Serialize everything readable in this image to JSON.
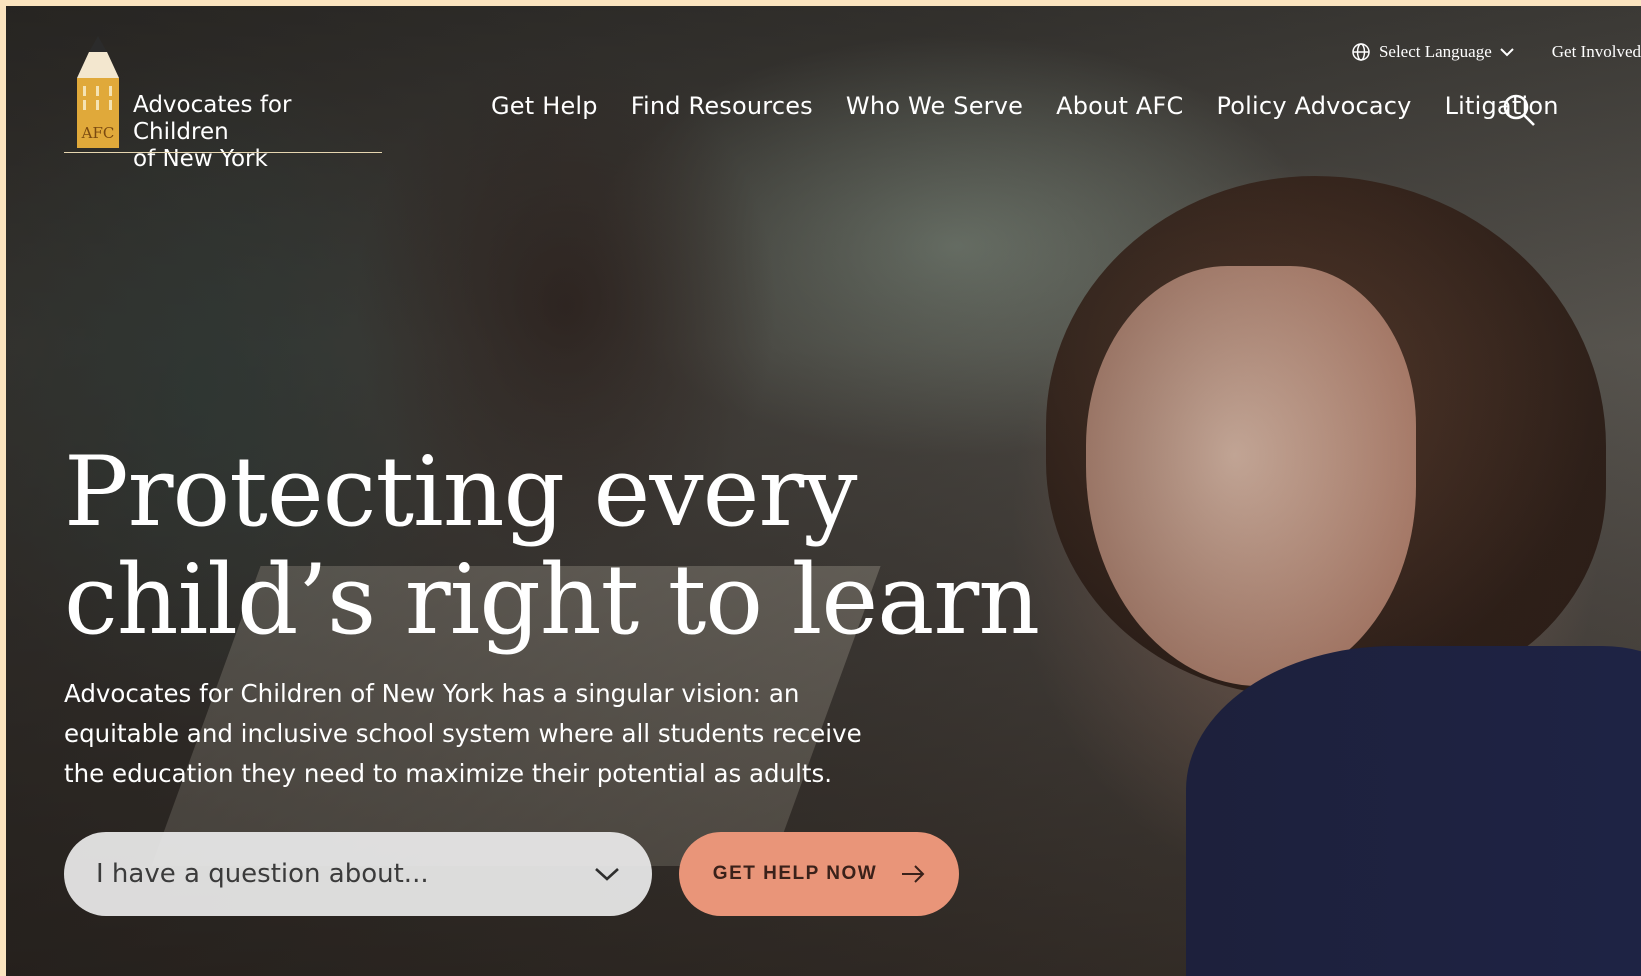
{
  "logo": {
    "line1": "Advocates for Children",
    "line2": "of New York",
    "badge": "AFC"
  },
  "utility": {
    "language_label": "Select Language",
    "get_involved": "Get Involved"
  },
  "nav": {
    "items": [
      "Get Help",
      "Find Resources",
      "Who We Serve",
      "About AFC",
      "Policy Advocacy",
      "Litigation"
    ]
  },
  "hero": {
    "headline_line1": "Protecting every",
    "headline_line2": "child’s right to learn",
    "description": "Advocates for Children of New York has a singular vision: an equitable and inclusive school system where all students receive the education they need to maximize their potential as adults.",
    "question_placeholder": "I have a question about...",
    "cta_label": "GET HELP NOW"
  },
  "icons": {
    "globe": "globe-icon",
    "chevron": "chevron-down-icon",
    "search": "search-icon",
    "arrow": "arrow-right-icon"
  },
  "colors": {
    "cta": "#e99579",
    "logo_pencil": "#e0a93a",
    "border": "#fbe4bf"
  }
}
